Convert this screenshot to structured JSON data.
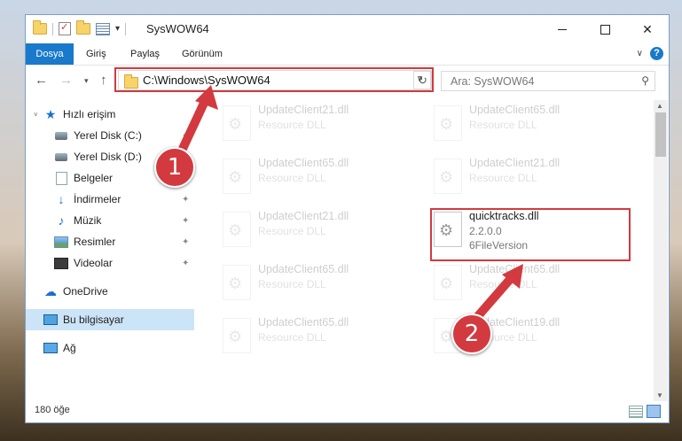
{
  "window": {
    "title": "SysWOW64",
    "controls": {
      "minimize": "—",
      "maximize": "☐",
      "close": "✕"
    }
  },
  "ribbon": {
    "tabs": [
      "Dosya",
      "Giriş",
      "Paylaş",
      "Görünüm"
    ],
    "help": "?"
  },
  "navbar": {
    "address": "C:\\Windows\\SysWOW64",
    "search_placeholder": "Ara: SysWOW64"
  },
  "sidebar": {
    "items": [
      {
        "label": "Hızlı erişim",
        "icon": "star-icon"
      },
      {
        "label": "Yerel Disk (C:)",
        "icon": "drive-icon"
      },
      {
        "label": "Yerel Disk (D:)",
        "icon": "drive-icon"
      },
      {
        "label": "Belgeler",
        "icon": "documents-icon"
      },
      {
        "label": "İndirmeler",
        "icon": "download-icon"
      },
      {
        "label": "Müzik",
        "icon": "music-icon"
      },
      {
        "label": "Resimler",
        "icon": "pictures-icon"
      },
      {
        "label": "Videolar",
        "icon": "video-icon"
      },
      {
        "label": "OneDrive",
        "icon": "cloud-icon"
      },
      {
        "label": "Bu bilgisayar",
        "icon": "computer-icon"
      },
      {
        "label": "Ağ",
        "icon": "network-icon"
      }
    ]
  },
  "files": [
    {
      "name": "UpdateClient21.dll",
      "desc": "Resource DLL"
    },
    {
      "name": "UpdateClient65.dll",
      "desc": "Resource DLL"
    },
    {
      "name": "UpdateClient65.dll",
      "desc": "Resource DLL"
    },
    {
      "name": "UpdateClient21.dll",
      "desc": "Resource DLL"
    },
    {
      "name": "UpdateClient21.dll",
      "desc": "Resource DLL"
    },
    {
      "name": "quicktracks.dll",
      "desc": "2.2.0.0",
      "version": "6FileVersion"
    },
    {
      "name": "UpdateClient65.dll",
      "desc": "Resource DLL"
    },
    {
      "name": "UpdateClient65.dll",
      "desc": "Resource DLL"
    },
    {
      "name": "UpdateClient65.dll",
      "desc": "Resource DLL"
    },
    {
      "name": "UpdateClient19.dll",
      "desc": "Resource DLL"
    }
  ],
  "status": {
    "count": "180 öğe"
  },
  "callouts": {
    "one": "1",
    "two": "2"
  },
  "colors": {
    "accent": "#1979ca",
    "highlight": "#d23a3f",
    "selection": "#cce4f7"
  }
}
